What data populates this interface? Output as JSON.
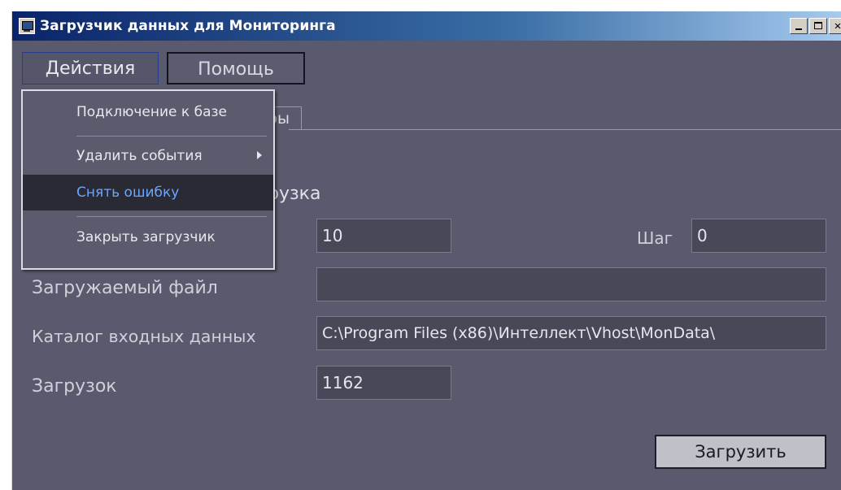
{
  "window": {
    "title": "Загрузчик данных для Мониторинга"
  },
  "menubar": {
    "actions_label": "Действия",
    "help_label": "Помощь"
  },
  "dropdown": {
    "items": [
      {
        "label": "Подключение к базе"
      },
      {
        "label": "Удалить события",
        "has_submenu": true
      },
      {
        "label": "Снять ошибку",
        "selected": true
      },
      {
        "label": "Закрыть загрузчик"
      }
    ]
  },
  "background": {
    "tab_fragment": "ры",
    "section_fragment": "рузка"
  },
  "form": {
    "interval_value": "10",
    "step_label": "Шаг",
    "step_value": "0",
    "file_label": "Загружаемый файл",
    "file_value": "",
    "catalog_label": "Каталог входных данных",
    "catalog_value": "C:\\Program Files (x86)\\Интеллект\\Vhost\\MonData\\",
    "loads_label": "Загрузок",
    "loads_value": "1162",
    "load_button": "Загрузить"
  },
  "colors": {
    "window_bg": "#5a5a6e",
    "menu_selected_text": "#6aa6ff"
  }
}
